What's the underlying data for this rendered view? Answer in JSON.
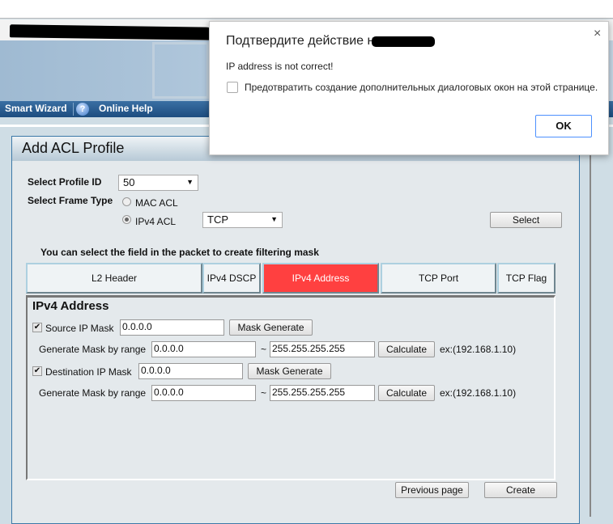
{
  "nav": {
    "smart_wizard": "Smart Wizard",
    "online_help": "Online Help",
    "help_icon": "?"
  },
  "panel": {
    "title": "Add ACL Profile"
  },
  "form": {
    "profile_id_label": "Select Profile ID",
    "profile_id_value": "50",
    "frame_type_label": "Select Frame Type",
    "mac_acl": "MAC ACL",
    "ipv4_acl": "IPv4 ACL",
    "selected_frame_type": "IPv4 ACL",
    "protocol_value": "TCP",
    "select_button": "Select",
    "hint": "You can select the field in the packet to create filtering mask"
  },
  "tabs": [
    {
      "label": "L2 Header"
    },
    {
      "label": "IPv4 DSCP"
    },
    {
      "label": "IPv4 Address",
      "active": true
    },
    {
      "label": "TCP Port"
    },
    {
      "label": "TCP Flag"
    }
  ],
  "ipv4": {
    "heading": "IPv4 Address",
    "source": {
      "label": "Source IP Mask",
      "checked": true,
      "value": "0.0.0.0",
      "mask_button": "Mask Generate",
      "range_label": "Generate Mask by range",
      "range_from": "0.0.0.0",
      "tilde": "~",
      "range_to": "255.255.255.255",
      "calc_button": "Calculate",
      "example": "ex:(192.168.1.10)"
    },
    "destination": {
      "label": "Destination IP Mask",
      "checked": true,
      "value": "0.0.0.0",
      "mask_button": "Mask Generate",
      "range_label": "Generate Mask by range",
      "range_from": "0.0.0.0",
      "tilde": "~",
      "range_to": "255.255.255.255",
      "calc_button": "Calculate",
      "example": "ex:(192.168.1.10)"
    }
  },
  "footer": {
    "previous": "Previous page",
    "create": "Create"
  },
  "dialog": {
    "title": "Подтвердите действие на",
    "message": "IP address is not correct!",
    "checkbox_label": "Предотвратить создание дополнительных диалоговых окон на этой странице.",
    "ok": "OK",
    "close": "×"
  },
  "colors": {
    "active_tab": "#ff4040",
    "nav": "#1d4d80"
  }
}
